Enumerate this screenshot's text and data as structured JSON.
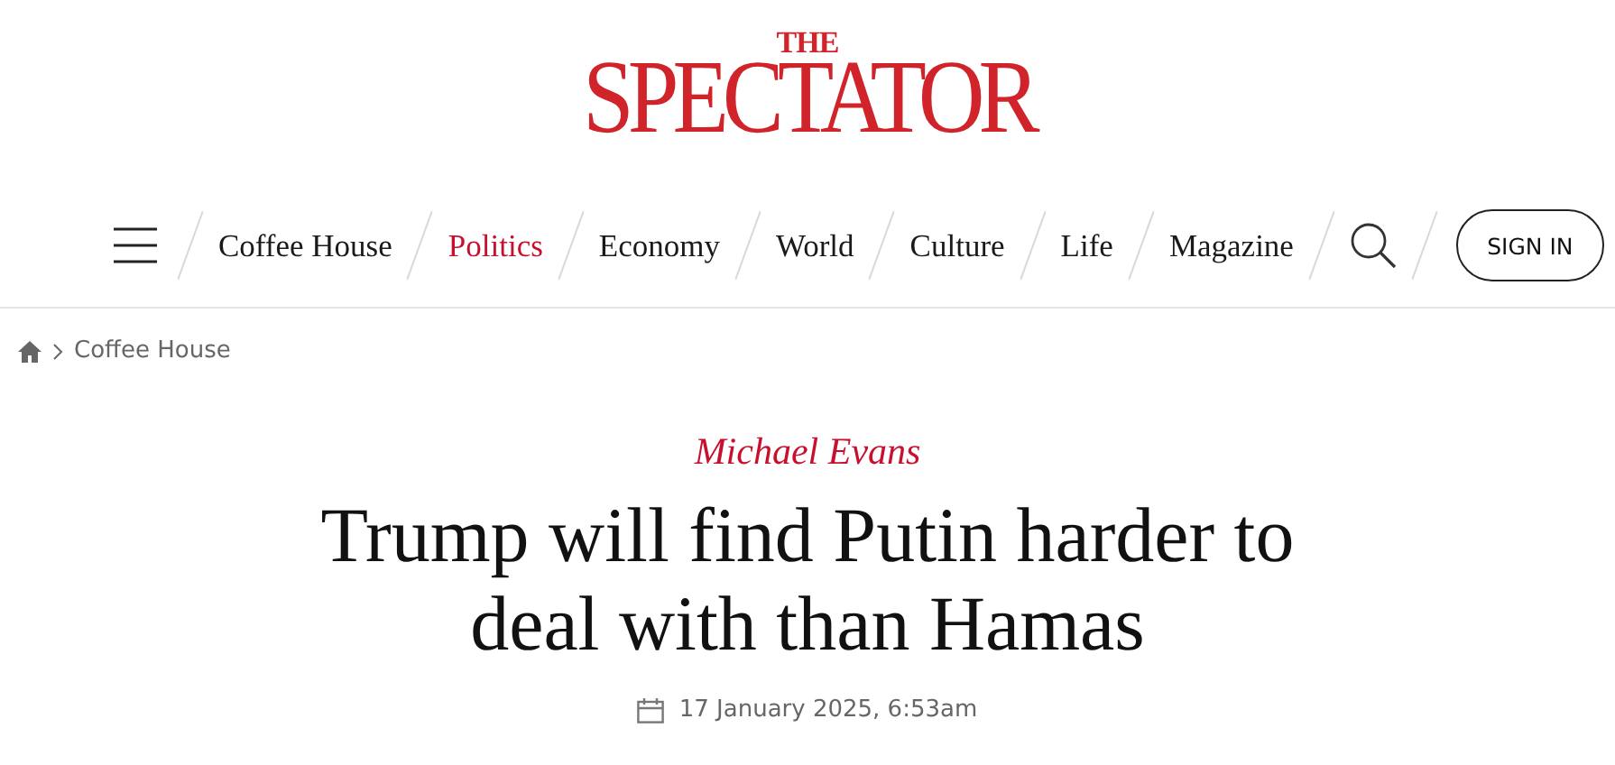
{
  "logo": {
    "small": "THE",
    "main": "SPECTATOR"
  },
  "nav": {
    "items": [
      {
        "label": "Coffee House",
        "selected": false
      },
      {
        "label": "Politics",
        "selected": true
      },
      {
        "label": "Economy",
        "selected": false
      },
      {
        "label": "World",
        "selected": false
      },
      {
        "label": "Culture",
        "selected": false
      },
      {
        "label": "Life",
        "selected": false
      },
      {
        "label": "Magazine",
        "selected": false
      }
    ],
    "sign_in": "SIGN IN"
  },
  "breadcrumb": [
    "Coffee House"
  ],
  "article": {
    "author": "Michael Evans",
    "title": "Trump will find Putin harder to deal with than Hamas",
    "date": "17 January 2025, 6:53am"
  }
}
